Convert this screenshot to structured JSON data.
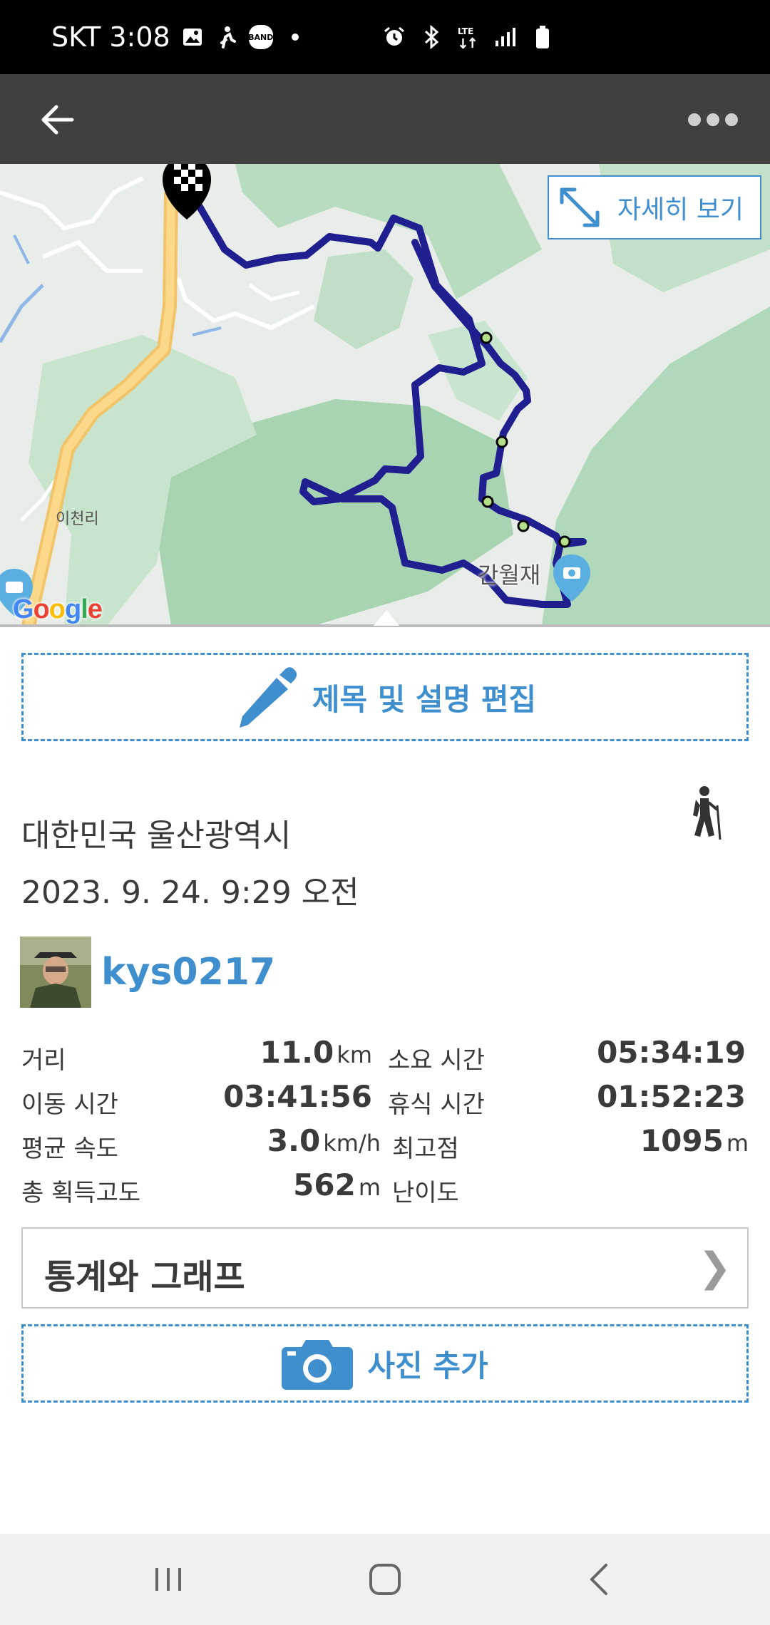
{
  "status_bar": {
    "carrier_time": "SKT 3:08",
    "band_badge": "BAND",
    "network": "LTE"
  },
  "map": {
    "detail_button_label": "자세히 보기",
    "village_label": "이천리",
    "pass_label": "간월재",
    "google_logo": "Google"
  },
  "edit_button_label": "제목 및 설명 편집",
  "activity": {
    "location": "대한민국 울산광역시",
    "datetime": "2023. 9. 24. 9:29 오전",
    "username": "kys0217"
  },
  "stats": {
    "distance_label": "거리",
    "distance_value": "11.0",
    "distance_unit": "km",
    "duration_label": "소요 시간",
    "duration_value": "05:34:19",
    "moving_label": "이동 시간",
    "moving_value": "03:41:56",
    "rest_label": "휴식 시간",
    "rest_value": "01:52:23",
    "speed_label": "평균 속도",
    "speed_value": "3.0",
    "speed_unit": "km/h",
    "max_alt_label": "최고점",
    "max_alt_value": "1095",
    "max_alt_unit": "m",
    "gain_label": "총 획득고도",
    "gain_value": "562",
    "gain_unit": "m",
    "difficulty_label": "난이도"
  },
  "graph_button_label": "통계와 그래프",
  "photo_button_label": "사진 추가",
  "colors": {
    "accent": "#3f8fcf",
    "app_bar": "#404040",
    "route": "#1f1f8f",
    "map_green": "#a8d4b2"
  },
  "icons": [
    "back-arrow-icon",
    "more-icon",
    "expand-icon",
    "pencil-icon",
    "hiker-icon",
    "camera-icon",
    "recents-icon",
    "home-icon",
    "nav-back-icon"
  ]
}
